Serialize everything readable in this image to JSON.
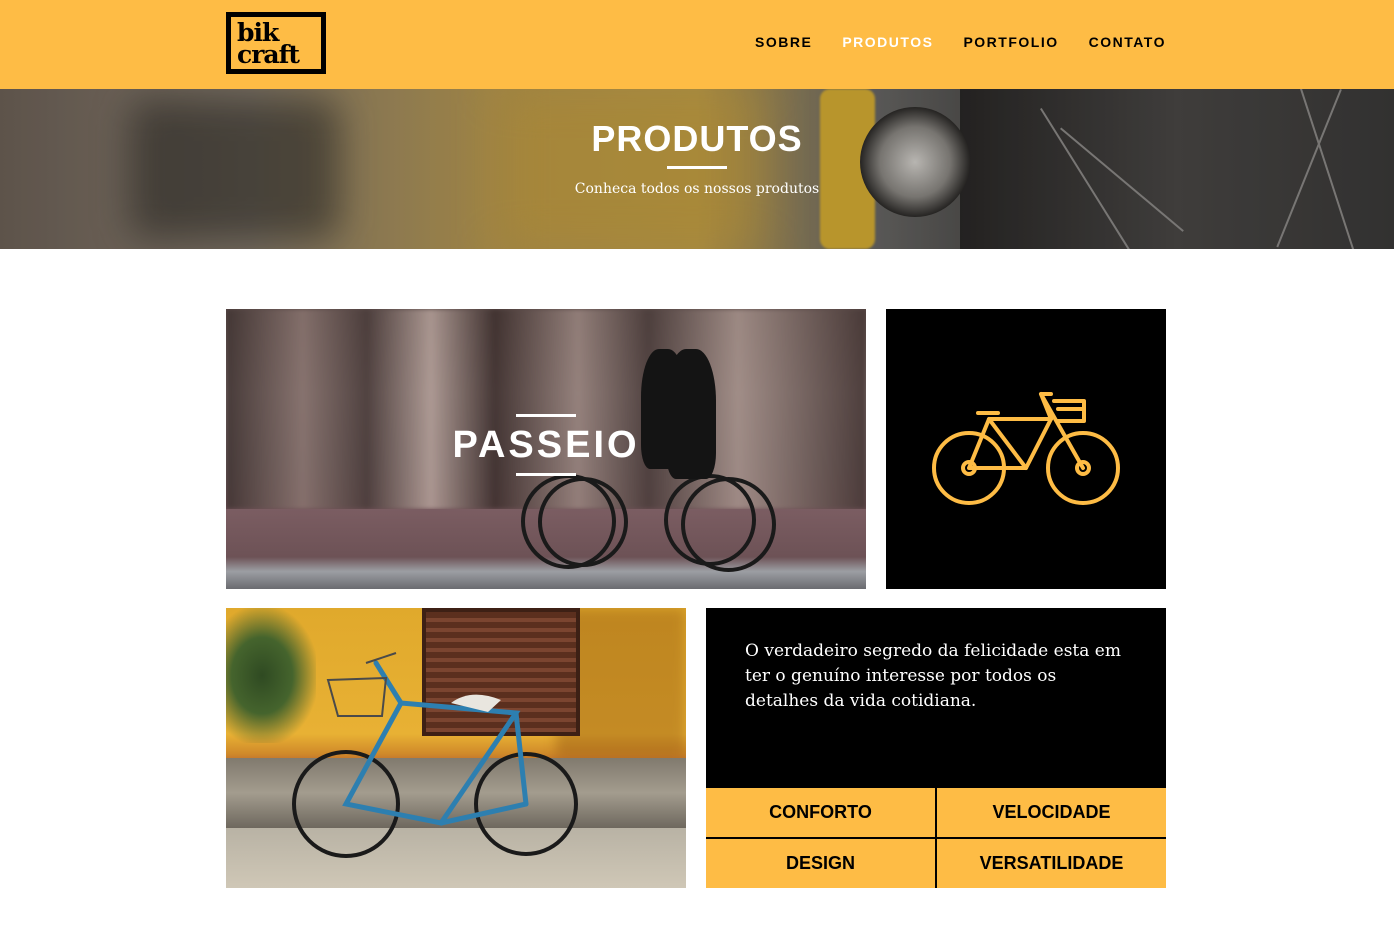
{
  "header": {
    "logo_line1": "bik",
    "logo_line2": "craft",
    "nav": [
      {
        "label": "SOBRE",
        "active": false
      },
      {
        "label": "PRODUTOS",
        "active": true
      },
      {
        "label": "PORTFOLIO",
        "active": false
      },
      {
        "label": "CONTATO",
        "active": false
      }
    ]
  },
  "hero": {
    "title": "PRODUTOS",
    "subtitle": "Conheca todos os nossos produtos"
  },
  "products": {
    "passeio_title": "PASSEIO",
    "bike_icon": "bicycle-icon",
    "quote": "O verdadeiro segredo da felicidade esta em ter o genuíno interesse por todos os detalhes da vida cotidiana.",
    "features": [
      "CONFORTO",
      "VELOCIDADE",
      "DESIGN",
      "VERSATILIDADE"
    ]
  },
  "colors": {
    "accent": "#FEBC45",
    "dark": "#000000",
    "light": "#FFFFFF"
  }
}
